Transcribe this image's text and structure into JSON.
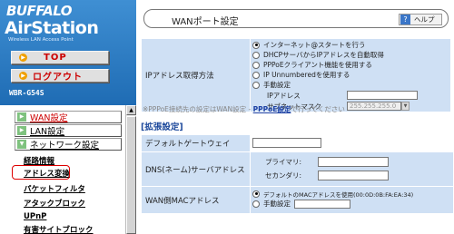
{
  "brand": {
    "company": "BUFFALO",
    "product": "AirStation",
    "subtitle": "Wireless LAN Access Point",
    "model": "WBR-G54S"
  },
  "nav_buttons": [
    {
      "label": "TOP"
    },
    {
      "label": "ログアウト"
    }
  ],
  "menu": {
    "categories": [
      {
        "label": "WAN設定",
        "active": true
      },
      {
        "label": "LAN設定",
        "active": false
      },
      {
        "label": "ネットワーク設定",
        "active": false
      }
    ],
    "sub_items": [
      {
        "label": "経路情報"
      },
      {
        "label": "アドレス変換",
        "highlighted": true
      },
      {
        "label": "パケットフィルタ"
      },
      {
        "label": "アタックブロック"
      },
      {
        "label": "UPnP"
      },
      {
        "label": "有害サイトブロック"
      }
    ]
  },
  "page": {
    "title": "WANポート設定",
    "help_label": "ヘルプ"
  },
  "ip_method": {
    "label": "IPアドレス取得方法",
    "options": [
      {
        "label": "インターネット@スタートを行う",
        "selected": true
      },
      {
        "label": "DHCPサーバからIPアドレスを自動取得",
        "selected": false
      },
      {
        "label": "PPPoEクライアント機能を使用する",
        "selected": false
      },
      {
        "label": "IP Unnumberedを使用する",
        "selected": false
      },
      {
        "label": "手動設定",
        "selected": false
      }
    ],
    "ip_address_label": "IPアドレス",
    "subnet_label": "サブネットマスク",
    "subnet_value": "255.255.255.0"
  },
  "note": {
    "prefix": "※PPPoE接続先の設定はWAN設定 - ",
    "link": "PPPoE設定",
    "suffix": "で行ってください"
  },
  "extended": {
    "heading": "[拡張設定]",
    "gateway_label": "デフォルトゲートウェイ",
    "dns_label": "DNS(ネーム)サーバアドレス",
    "dns_primary_label": "プライマリ:",
    "dns_secondary_label": "セカンダリ:",
    "mac_label": "WAN側MACアドレス",
    "mac_options": [
      {
        "label": "デフォルトのMACアドレスを使用(00:0D:0B:FA:EA:34)",
        "selected": true
      },
      {
        "label": "手動設定",
        "selected": false
      }
    ]
  },
  "colors": {
    "brand_blue": "#2f7ec6",
    "table_bg": "#cfe0f4",
    "active_red": "#cc0000",
    "heading_blue": "#1e4a9c"
  }
}
